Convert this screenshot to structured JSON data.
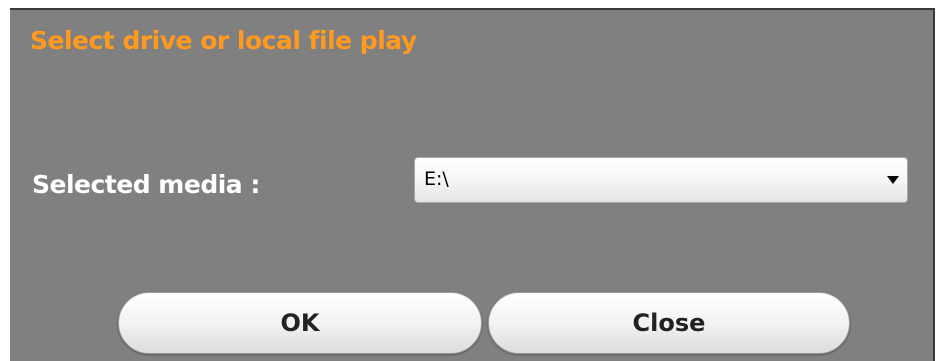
{
  "dialog": {
    "title": "Select drive or local file play",
    "media_label": "Selected media :",
    "media_select": {
      "value": "E:\\",
      "icon": "triangle-down-icon"
    },
    "buttons": {
      "ok": "OK",
      "close": "Close"
    }
  },
  "colors": {
    "background": "#808080",
    "title": "#ff9a1f",
    "label": "#ffffff"
  }
}
